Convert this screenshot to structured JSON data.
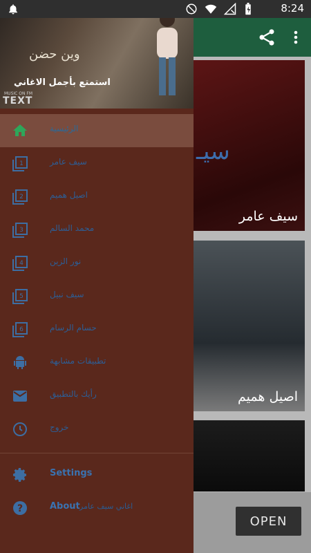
{
  "status_bar": {
    "time": "8:24",
    "icons": [
      "notification-bell-icon",
      "do-not-disturb-icon",
      "wifi-icon",
      "signal-icon",
      "battery-icon"
    ]
  },
  "background_app": {
    "toolbar_icons": [
      "share-icon",
      "overflow-menu-icon"
    ],
    "cards": [
      {
        "title": "سيف عامر",
        "art_text": "سيـ"
      },
      {
        "title": "اصيل هميم"
      },
      {
        "title": ""
      }
    ],
    "open_button": "OPEN"
  },
  "drawer": {
    "header": {
      "logo": "وين حضن",
      "subtitle": "استمتع بأجمل الاغاني",
      "watermark_small": "MUSIC ON FM",
      "watermark_large": "TEXT"
    },
    "items": [
      {
        "label": "الرئيسية",
        "icon": "home-icon",
        "active": true
      },
      {
        "label": "سيف عامر",
        "icon": "music-library-icon"
      },
      {
        "label": "اصيل هميم",
        "icon": "music-library-icon"
      },
      {
        "label": "محمد السالم",
        "icon": "music-library-icon"
      },
      {
        "label": "نور الزين",
        "icon": "music-library-icon"
      },
      {
        "label": "سيف نبيل",
        "icon": "music-library-icon"
      },
      {
        "label": "حسام الرسام",
        "icon": "music-library-icon"
      },
      {
        "label": "تطبيقات مشابهة",
        "icon": "android-icon"
      },
      {
        "label": "رأيك بالتطبيق",
        "icon": "mail-icon"
      },
      {
        "label": "خروج",
        "icon": "exit-icon"
      }
    ],
    "footer_items": [
      {
        "label": "Settings",
        "icon": "gear-icon"
      },
      {
        "label": "About",
        "extra": "اغاني سيف عامر",
        "icon": "help-icon"
      }
    ]
  },
  "colors": {
    "drawer_bg": "#5a281c",
    "active_item": "#7a4c3e",
    "home_icon": "#2ea65a",
    "item_icon": "#3d6ea3",
    "label_text": "#2d5e95",
    "toolbar": "#1e5e3e"
  }
}
